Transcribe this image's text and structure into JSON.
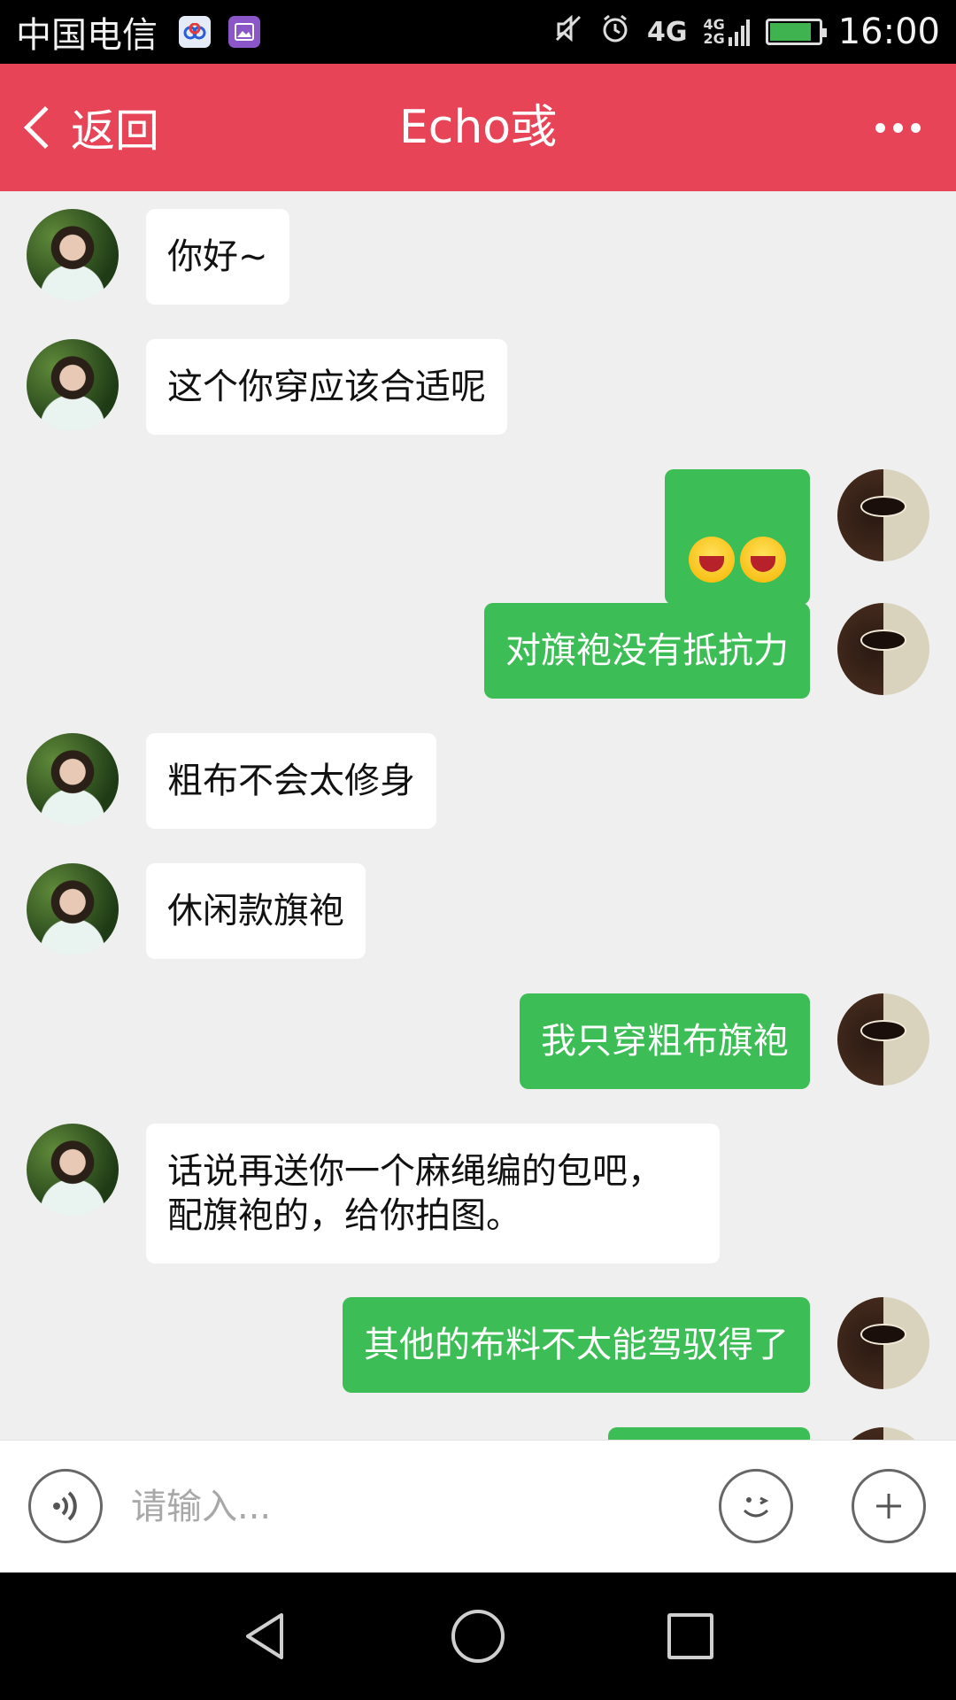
{
  "status_bar": {
    "carrier": "中国电信",
    "time": "16:00",
    "network_primary": "4G",
    "network_secondary_top": "4G",
    "network_secondary_bottom": "2G",
    "battery_level": 0.85,
    "icons": [
      "baidu-cloud-icon",
      "gallery-icon",
      "mute-vibrate-icon",
      "alarm-icon",
      "signal-4g-icon",
      "signal-strength-icon",
      "battery-icon"
    ]
  },
  "header": {
    "back_label": "返回",
    "title": "Echo彧",
    "more_icon": "more-dots-icon",
    "color": "#e74457"
  },
  "messages": [
    {
      "sender": "them",
      "text": "你好~"
    },
    {
      "sender": "them",
      "text": "这个你穿应该合适呢"
    },
    {
      "sender": "me",
      "text": "",
      "emoji": [
        "laughing-emoji",
        "laughing-emoji"
      ]
    },
    {
      "sender": "me",
      "text": "对旗袍没有抵抗力"
    },
    {
      "sender": "them",
      "text": "粗布不会太修身"
    },
    {
      "sender": "them",
      "text": "休闲款旗袍"
    },
    {
      "sender": "me",
      "text": "我只穿粗布旗袍"
    },
    {
      "sender": "them",
      "text": "话说再送你一个麻绳编的包吧，\n配旗袍的，给你拍图。"
    },
    {
      "sender": "me",
      "text": "其他的布料不太能驾驭得了"
    },
    {
      "sender": "me",
      "text": ""
    }
  ],
  "input_bar": {
    "placeholder": "请输入...",
    "value": "",
    "voice_icon": "voice-icon",
    "emoji_icon": "emoji-icon",
    "plus_icon": "plus-icon"
  },
  "nav_bar": {
    "icons": [
      "nav-back-icon",
      "nav-home-icon",
      "nav-recents-icon"
    ]
  },
  "colors": {
    "header": "#e74457",
    "outgoing_bubble": "#3dbd55",
    "incoming_bubble": "#ffffff",
    "chat_background": "#efefef"
  }
}
